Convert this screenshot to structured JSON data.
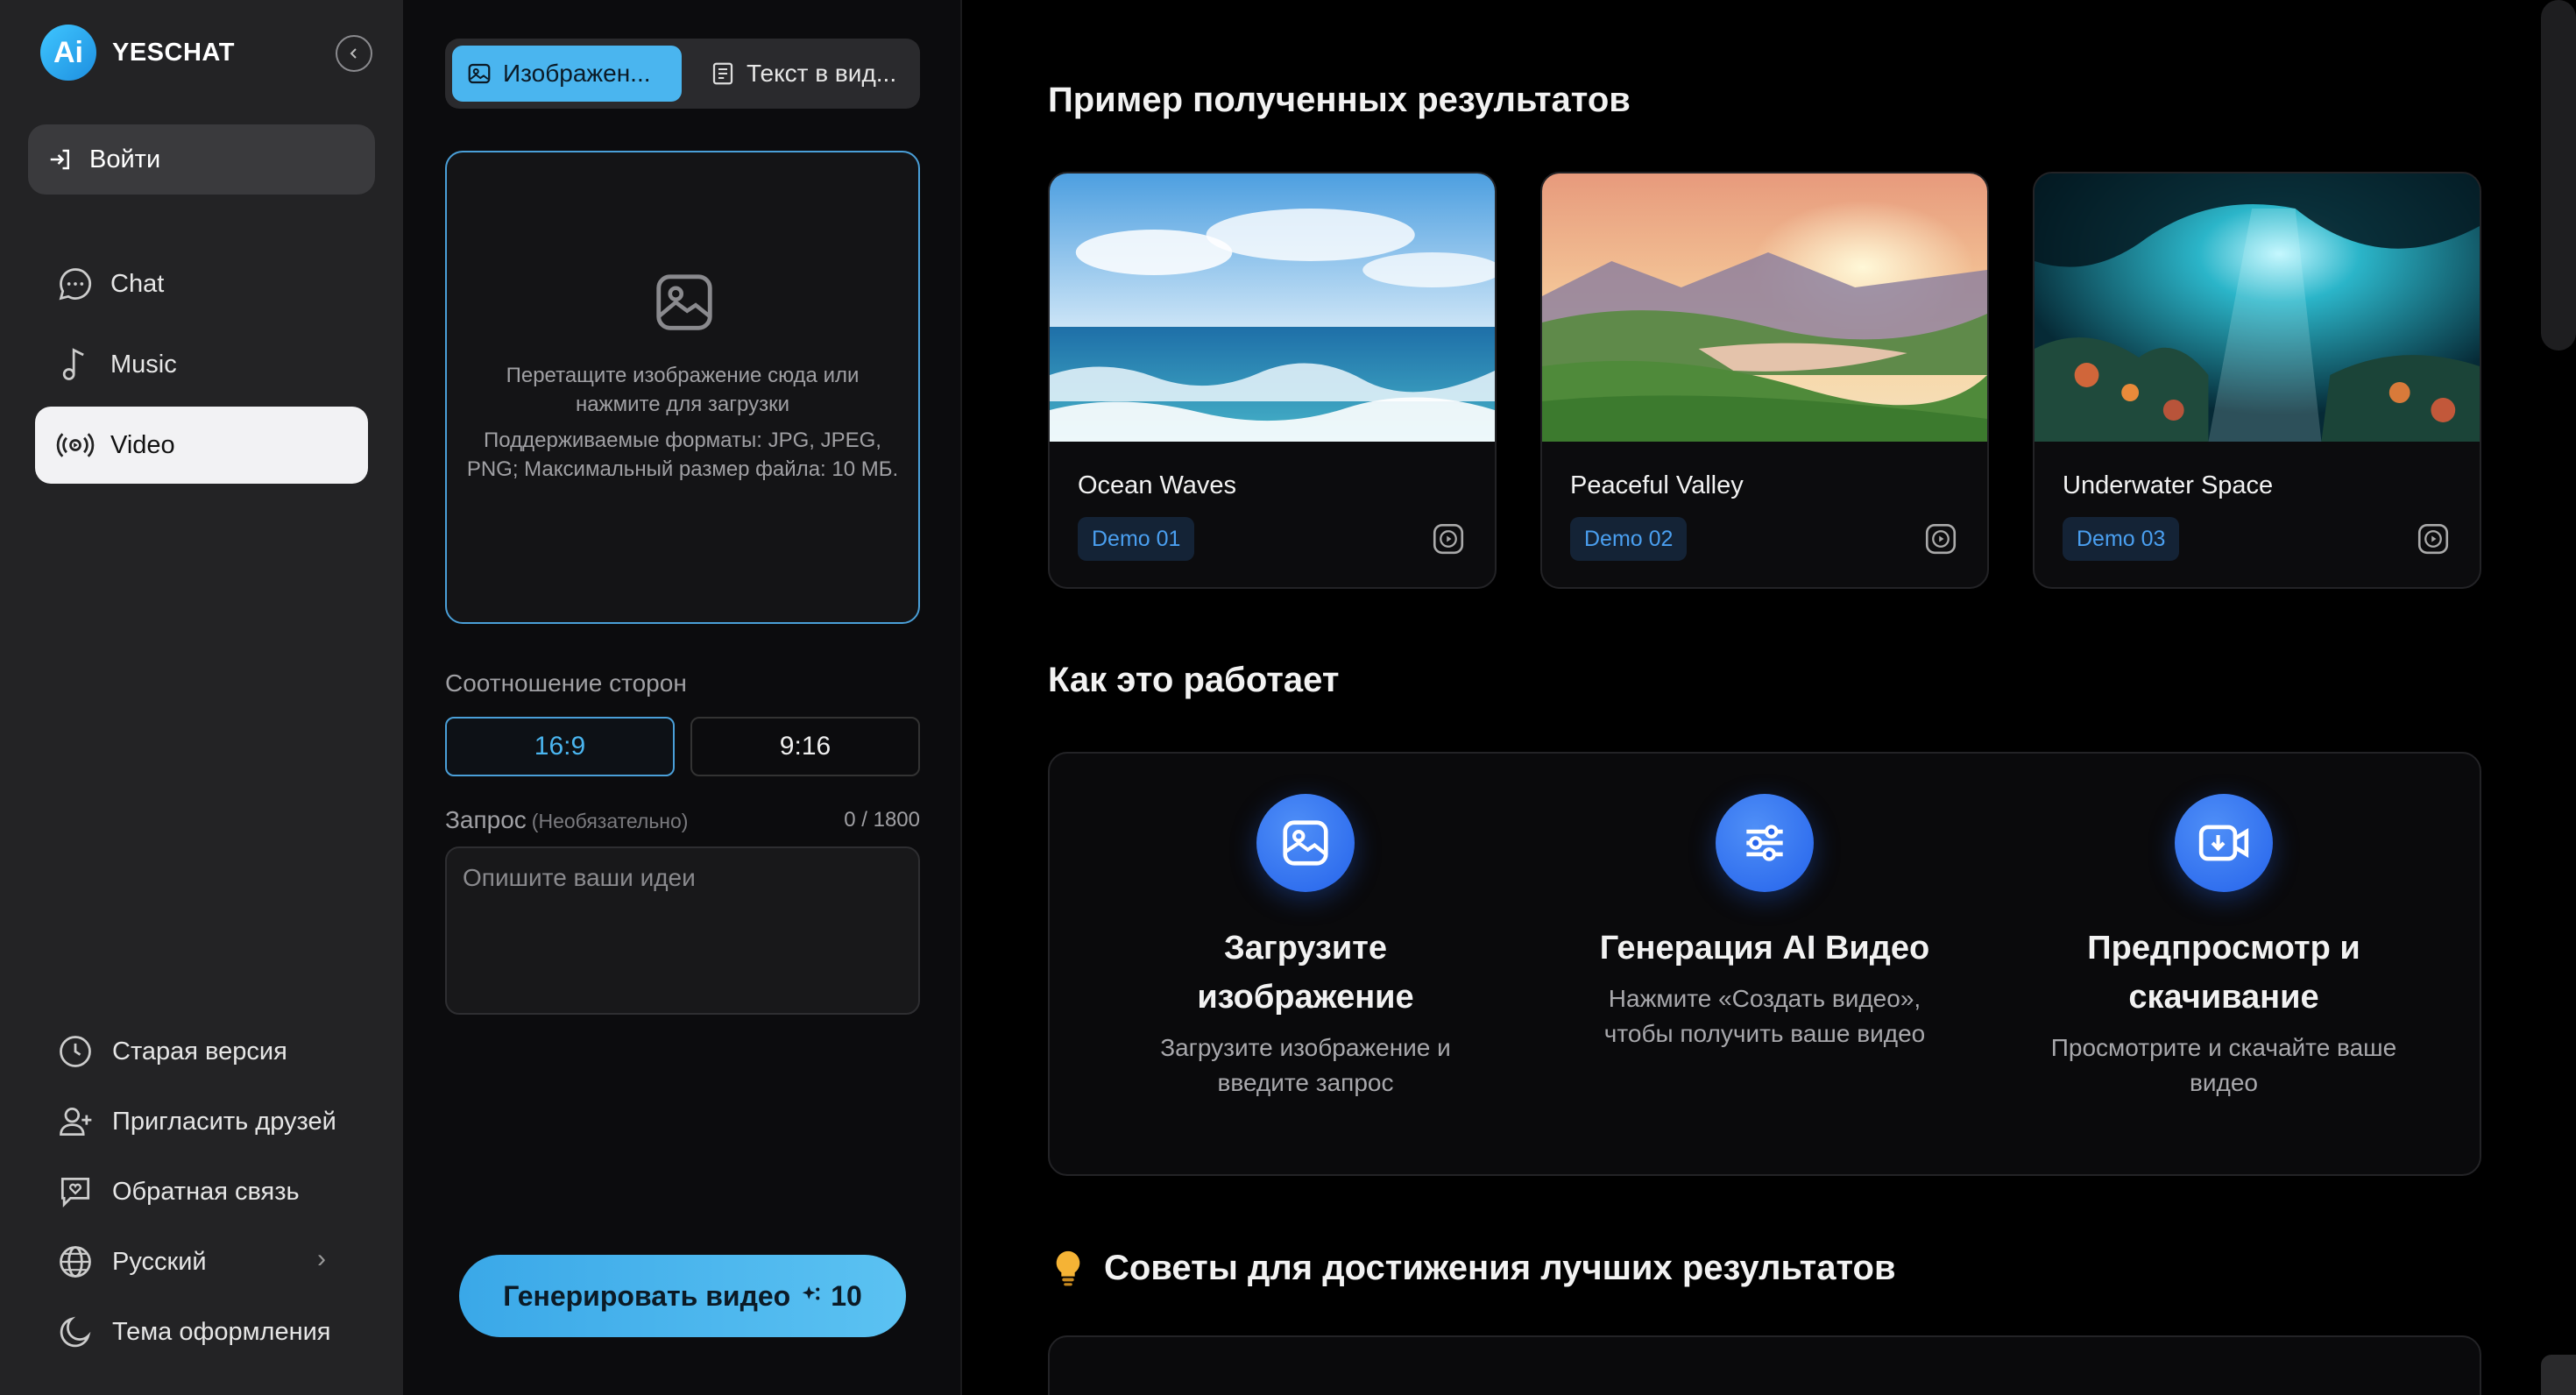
{
  "sidebar": {
    "brand": "YESCHAT",
    "login_label": "Войти",
    "nav": [
      {
        "label": "Chat",
        "icon": "chat-bubble-icon"
      },
      {
        "label": "Music",
        "icon": "music-note-icon"
      },
      {
        "label": "Video",
        "icon": "video-broadcast-icon",
        "active": true
      }
    ],
    "bottom": [
      {
        "label": "Старая версия",
        "icon": "history-clock-icon"
      },
      {
        "label": "Пригласить друзей",
        "icon": "invite-user-icon"
      },
      {
        "label": "Обратная связь",
        "icon": "feedback-heart-icon"
      },
      {
        "label": "Русский",
        "icon": "globe-icon"
      },
      {
        "label": "Тема оформления",
        "icon": "moon-icon"
      }
    ]
  },
  "form": {
    "tabs": [
      {
        "label": "Изображен...",
        "active": true
      },
      {
        "label": "Текст в вид...",
        "active": false
      }
    ],
    "dropzone": {
      "line1": "Перетащите изображение сюда или нажмите для загрузки",
      "line2": "Поддерживаемые форматы: JPG, JPEG, PNG; Максимальный размер файла: 10 МБ."
    },
    "ratio_label": "Соотношение сторон",
    "ratios": [
      "16:9",
      "9:16"
    ],
    "selected_ratio": "16:9",
    "prompt_label": "Запрос",
    "prompt_optional": "(Необязательно)",
    "prompt_count": "0 / 1800",
    "prompt_placeholder": "Опишите ваши идеи",
    "prompt_value": "",
    "generate_label": "Генерировать видео",
    "generate_cost": "10"
  },
  "main": {
    "examples_title": "Пример полученных результатов",
    "examples": [
      {
        "title": "Ocean Waves",
        "badge": "Demo 01"
      },
      {
        "title": "Peaceful Valley",
        "badge": "Demo 02"
      },
      {
        "title": "Underwater Space",
        "badge": "Demo 03"
      }
    ],
    "how_title": "Как это работает",
    "steps": [
      {
        "title": "Загрузите изображение",
        "desc": "Загрузите изображение и введите запрос",
        "icon": "upload-image-icon"
      },
      {
        "title": "Генерация AI Видео",
        "desc": "Нажмите «Создать видео», чтобы получить ваше видео",
        "icon": "sliders-icon"
      },
      {
        "title": "Предпросмотр и скачивание",
        "desc": "Просмотрите и скачайте ваше видео",
        "icon": "video-download-icon"
      }
    ],
    "tips_title": "Советы для достижения лучших результатов"
  },
  "colors": {
    "accent": "#4ab5ef",
    "step_icon": "#2563eb",
    "badge_text": "#4a9ff0"
  }
}
